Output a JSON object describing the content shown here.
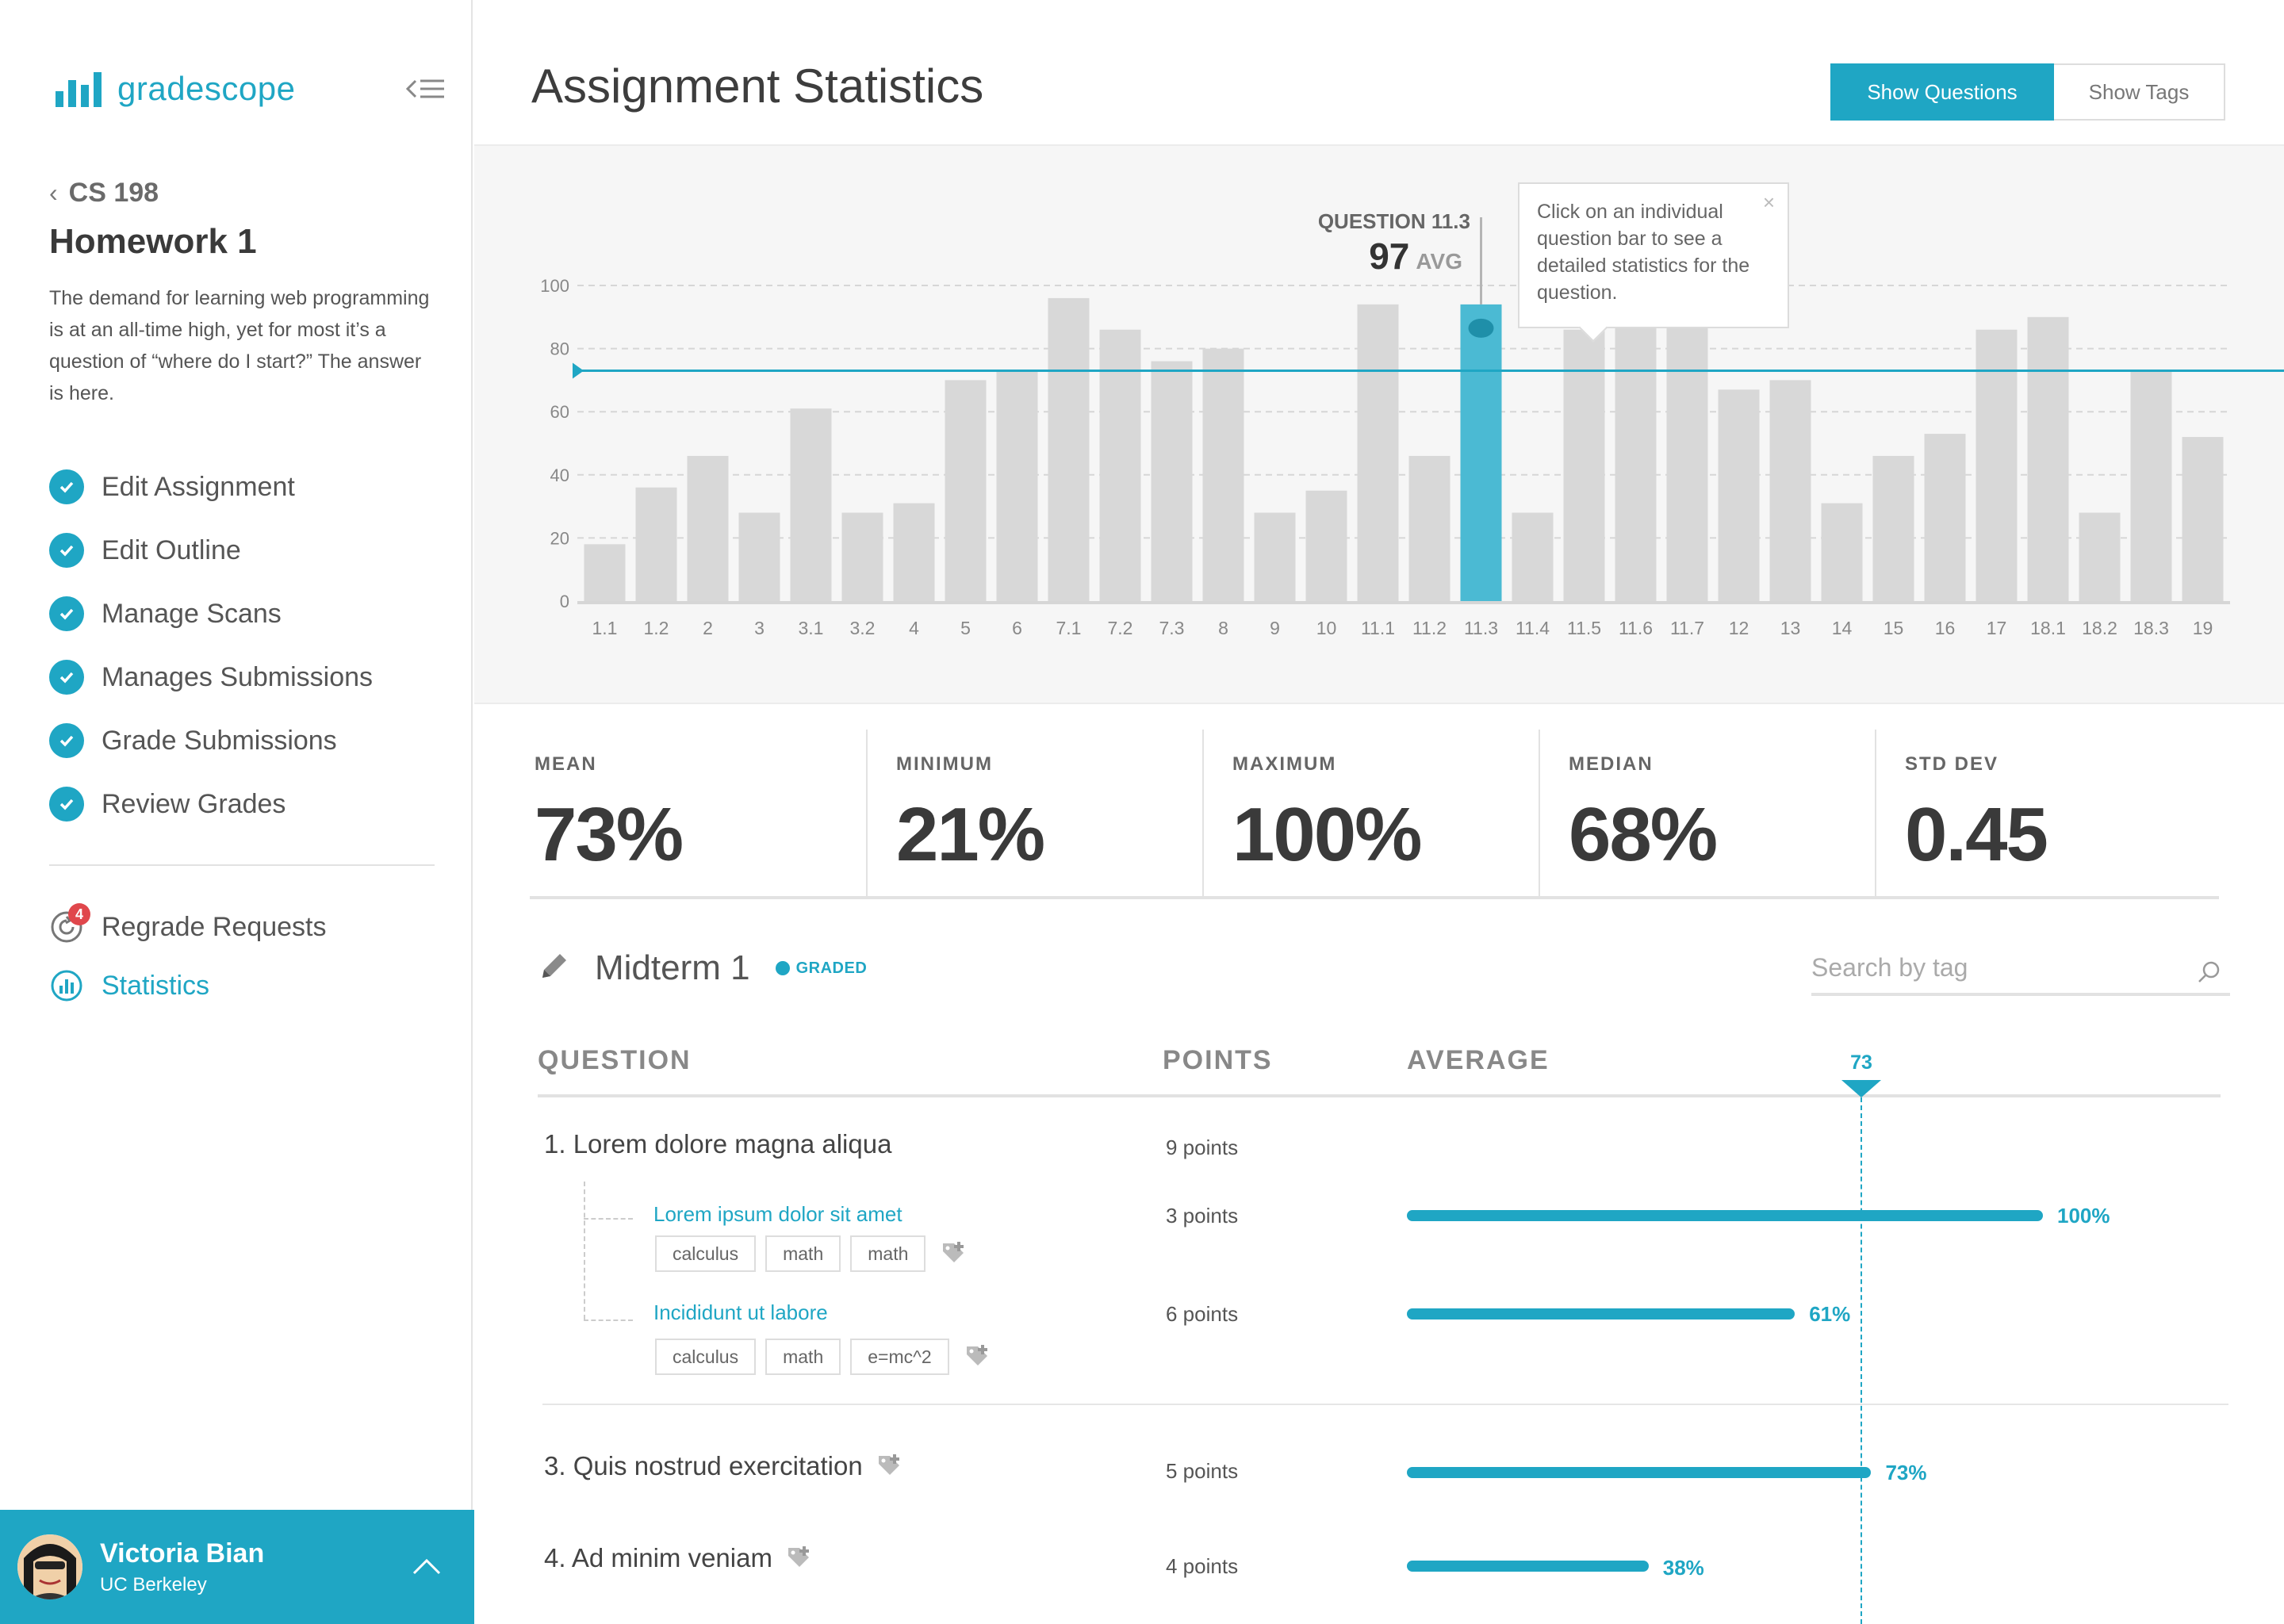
{
  "app": {
    "name": "gradescope"
  },
  "sidebar": {
    "course": "CS 198",
    "assignment_title": "Homework 1",
    "description": "The demand for learning web programming is at an all-time high, yet for most it’s a question of “where do I start?” The answer is here.",
    "steps": [
      {
        "label": "Edit Assignment"
      },
      {
        "label": "Edit Outline"
      },
      {
        "label": "Manage Scans"
      },
      {
        "label": "Manages Submissions"
      },
      {
        "label": "Grade Submissions"
      },
      {
        "label": "Review Grades"
      }
    ],
    "regrade": {
      "label": "Regrade Requests",
      "badge": "4"
    },
    "statistics": {
      "label": "Statistics"
    }
  },
  "user": {
    "name": "Victoria Bian",
    "org": "UC Berkeley"
  },
  "header": {
    "title": "Assignment Statistics",
    "show_questions": "Show Questions",
    "show_tags": "Show Tags"
  },
  "tooltip": {
    "text": "Click on an individual question bar to see a detailed statistics for the question.",
    "close": "×"
  },
  "selected_question": {
    "label": "QUESTION 11.3",
    "value": "97",
    "unit": "AVG"
  },
  "chart_data": {
    "type": "bar",
    "categories": [
      "1.1",
      "1.2",
      "2",
      "3",
      "3.1",
      "3.2",
      "4",
      "5",
      "6",
      "7.1",
      "7.2",
      "7.3",
      "8",
      "9",
      "10",
      "11.1",
      "11.2",
      "11.3",
      "11.4",
      "11.5",
      "11.6",
      "11.7",
      "12",
      "13",
      "14",
      "15",
      "16",
      "17",
      "18.1",
      "18.2",
      "18.3",
      "19"
    ],
    "values": [
      18,
      36,
      46,
      28,
      61,
      28,
      31,
      70,
      73,
      96,
      86,
      76,
      80,
      28,
      35,
      94,
      46,
      94,
      28,
      86,
      88,
      88,
      67,
      70,
      31,
      46,
      53,
      86,
      90,
      28,
      73,
      52
    ],
    "ylim": [
      0,
      100
    ],
    "yticks": [
      "0",
      "20",
      "40",
      "60",
      "80",
      "100"
    ],
    "mean_line": 73,
    "highlight": "11.3",
    "grid": true
  },
  "stats": [
    {
      "label": "MEAN",
      "value": "73%"
    },
    {
      "label": "MINIMUM",
      "value": "21%"
    },
    {
      "label": "MAXIMUM",
      "value": "100%"
    },
    {
      "label": "MEDIAN",
      "value": "68%"
    },
    {
      "label": "STD DEV",
      "value": "0.45"
    }
  ],
  "section": {
    "title": "Midterm 1",
    "status": "GRADED",
    "search_placeholder": "Search by tag"
  },
  "table": {
    "col_question": "QUESTION",
    "col_points": "POINTS",
    "col_average": "AVERAGE",
    "avg_marker": "73",
    "avg_marker_value": 73,
    "rows": [
      {
        "title": "1. Lorem dolore magna aliqua",
        "points": "9 points"
      },
      {
        "title": "3. Quis nostrud exercitation",
        "points": "5 points",
        "avg_label": "73%",
        "avg": 73
      },
      {
        "title": "4. Ad minim veniam",
        "points": "4 points",
        "avg_label": "38%",
        "avg": 38
      }
    ],
    "subrows": [
      {
        "title": "Lorem ipsum dolor sit amet",
        "points": "3 points",
        "avg_label": "100%",
        "avg": 100,
        "tags": [
          "calculus",
          "math",
          "math"
        ]
      },
      {
        "title": "Incididunt ut labore",
        "points": "6 points",
        "avg_label": "61%",
        "avg": 61,
        "tags": [
          "calculus",
          "math",
          "e=mc^2"
        ]
      }
    ]
  },
  "colors": {
    "accent": "#1fa6c4",
    "bar": "#d8d8d8",
    "badge": "#e0474c"
  },
  "icons": [
    "logo-bars-icon",
    "collapse-menu-icon",
    "chevron-left-icon",
    "check-circle-icon",
    "regrade-icon",
    "statistics-icon",
    "close-icon",
    "pencil-icon",
    "search-icon",
    "add-tag-icon",
    "chevron-up-icon"
  ]
}
